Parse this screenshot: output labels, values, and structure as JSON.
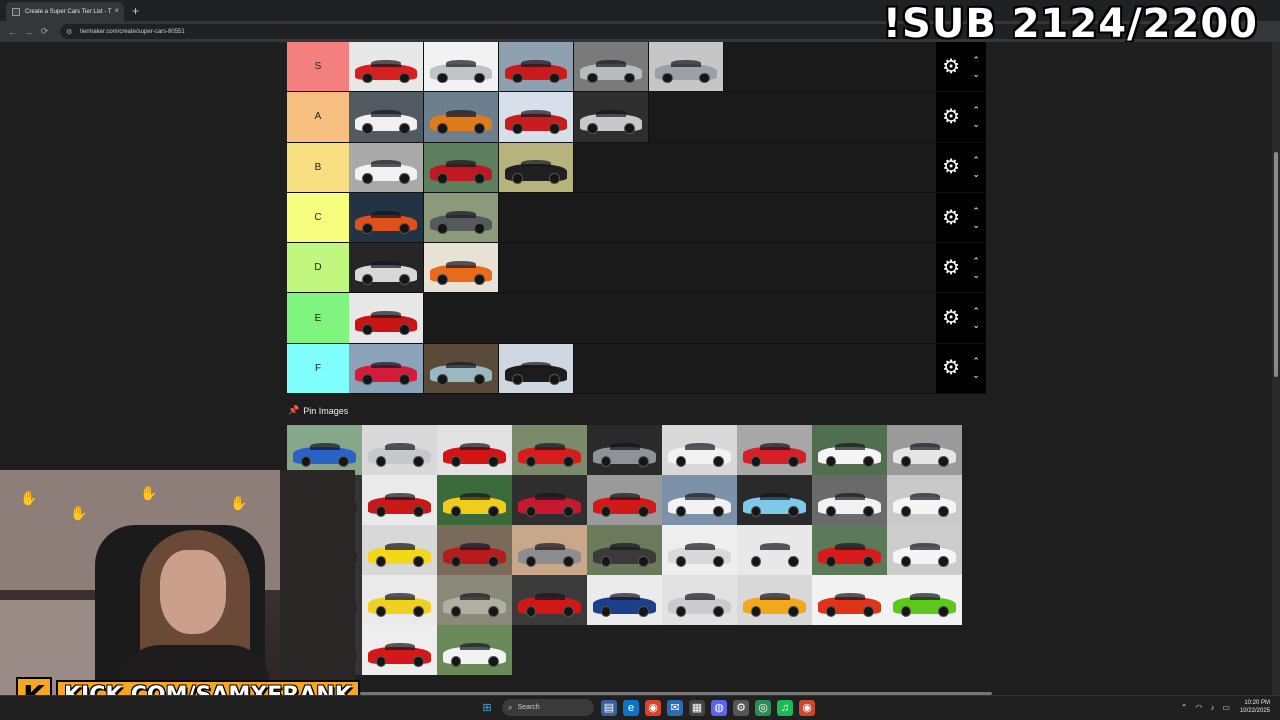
{
  "browser": {
    "tab_title": "Create a Super Cars Tier List - T",
    "tab_close": "×",
    "new_tab": "+",
    "url": "tiermaker.com/create/super-cars-80551",
    "nav": {
      "back": "←",
      "forward": "→",
      "reload": "⟳"
    }
  },
  "overlay": {
    "sub_counter": "!SUB 2124/2200"
  },
  "tiers": [
    {
      "label": "S",
      "color": "#f47f7f",
      "cars": [
        {
          "color": "#d81f1f",
          "bg": "#e8e8e8"
        },
        {
          "color": "#bfc4c8",
          "bg": "#f2f2f2"
        },
        {
          "color": "#cc1a1a",
          "bg": "#8fa0b0"
        },
        {
          "color": "#b8bcc0",
          "bg": "#7a7a7a"
        },
        {
          "color": "#9aa0a8",
          "bg": "#c6c6c6"
        }
      ]
    },
    {
      "label": "A",
      "color": "#f7bf80",
      "cars": [
        {
          "color": "#f0f0f0",
          "bg": "#505a60"
        },
        {
          "color": "#e07b1c",
          "bg": "#6b7f8c"
        },
        {
          "color": "#c81d1d",
          "bg": "#d7e0ea"
        },
        {
          "color": "#c8c8c8",
          "bg": "#2e2e2e"
        }
      ]
    },
    {
      "label": "B",
      "color": "#f7de80",
      "cars": [
        {
          "color": "#f2f2f2",
          "bg": "#a9a9a9"
        },
        {
          "color": "#c01822",
          "bg": "#5d7f5e"
        },
        {
          "color": "#202020",
          "bg": "#b6b47c"
        }
      ]
    },
    {
      "label": "C",
      "color": "#f7fd7f",
      "cars": [
        {
          "color": "#e0501a",
          "bg": "#223344"
        },
        {
          "color": "#55595c",
          "bg": "#8a9a7a"
        }
      ]
    },
    {
      "label": "D",
      "color": "#bff77f",
      "cars": [
        {
          "color": "#d8d8d8",
          "bg": "#262626"
        },
        {
          "color": "#ea6a1b",
          "bg": "#e8e2d6"
        }
      ]
    },
    {
      "label": "E",
      "color": "#7ff57f",
      "cars": [
        {
          "color": "#c81414",
          "bg": "#e8e8e8"
        }
      ]
    },
    {
      "label": "F",
      "color": "#7ffefe",
      "cars": [
        {
          "color": "#d21c3a",
          "bg": "#8aa3b8"
        },
        {
          "color": "#9bb7c2",
          "bg": "#5a4a3a"
        },
        {
          "color": "#1c1c1c",
          "bg": "#cfd8e0"
        }
      ]
    }
  ],
  "pin_images": {
    "label": "Pin Images",
    "cars": [
      {
        "color": "#2a63c8",
        "bg": "#86a78a"
      },
      {
        "color": "#c5c8cc",
        "bg": "#d9d9d9"
      },
      {
        "color": "#d41414",
        "bg": "#e2e2e2"
      },
      {
        "color": "#d81c1c",
        "bg": "#7a8a6a"
      },
      {
        "color": "#8e939a",
        "bg": "#2a2a2a"
      },
      {
        "color": "#f2f2f2",
        "bg": "#d9d9d9"
      },
      {
        "color": "#d61f28",
        "bg": "#a7a7a7"
      },
      {
        "color": "#f5f5f5",
        "bg": "#4f6f4f"
      },
      {
        "color": "#e6e6e6",
        "bg": "#9a9a9a"
      },
      {
        "color": "#1e1e1e",
        "bg": "#333333"
      },
      {
        "color": "#c81818",
        "bg": "#eaeaea"
      },
      {
        "color": "#f0cc1c",
        "bg": "#3a6a3a"
      },
      {
        "color": "#c81830",
        "bg": "#2e2e2e"
      },
      {
        "color": "#d41818",
        "bg": "#9a9a9a"
      },
      {
        "color": "#f2f2f2",
        "bg": "#7c92a8"
      },
      {
        "color": "#7ec8e8",
        "bg": "#2a2a2a"
      },
      {
        "color": "#f2f2f2",
        "bg": "#6a6a6a"
      },
      {
        "color": "#f5f5f5",
        "bg": "#c9c9c9"
      },
      {
        "color": "#1e1e1e",
        "bg": "#333333"
      },
      {
        "color": "#f2d818",
        "bg": "#d8d8d8"
      },
      {
        "color": "#b81a1a",
        "bg": "#7a6a5a"
      },
      {
        "color": "#8d8d8d",
        "bg": "#c9a88a"
      },
      {
        "color": "#3a3a3a",
        "bg": "#6a7a5a"
      },
      {
        "color": "#d9d9d9",
        "bg": "#eeeeee"
      },
      {
        "color": "#e8e8e8",
        "bg": "#e8e8e8"
      },
      {
        "color": "#d81a1a",
        "bg": "#5a7a5a"
      },
      {
        "color": "#f5f5f5",
        "bg": "#cccccc"
      },
      {
        "color": "#1e1e1e",
        "bg": "#333333"
      },
      {
        "color": "#f0d020",
        "bg": "#eaeaea"
      },
      {
        "color": "#b0b0a0",
        "bg": "#8a8a7a"
      },
      {
        "color": "#d01818",
        "bg": "#3a3a3a"
      },
      {
        "color": "#1c3f8a",
        "bg": "#ebebeb"
      },
      {
        "color": "#c8ccd0",
        "bg": "#e2e2e2"
      },
      {
        "color": "#f2a81c",
        "bg": "#d8d8d8"
      },
      {
        "color": "#e0341a",
        "bg": "#f2f2f2"
      },
      {
        "color": "#5cc81c",
        "bg": "#f2f2f2"
      },
      {
        "color": "#1e1e1e",
        "bg": "#333333"
      },
      {
        "color": "#d41818",
        "bg": "#eeeeee"
      },
      {
        "color": "#f2f2f2",
        "bg": "#6a8a5a"
      }
    ]
  },
  "controls": {
    "gear": "⚙",
    "up": "⌃",
    "down": "⌄"
  },
  "stream": {
    "kick_letter": "K",
    "kick_url": "KICK.COM/SAMXFRANK"
  },
  "taskbar": {
    "search_placeholder": "Search",
    "time": "10:20 PM",
    "date": "10/22/2025"
  }
}
